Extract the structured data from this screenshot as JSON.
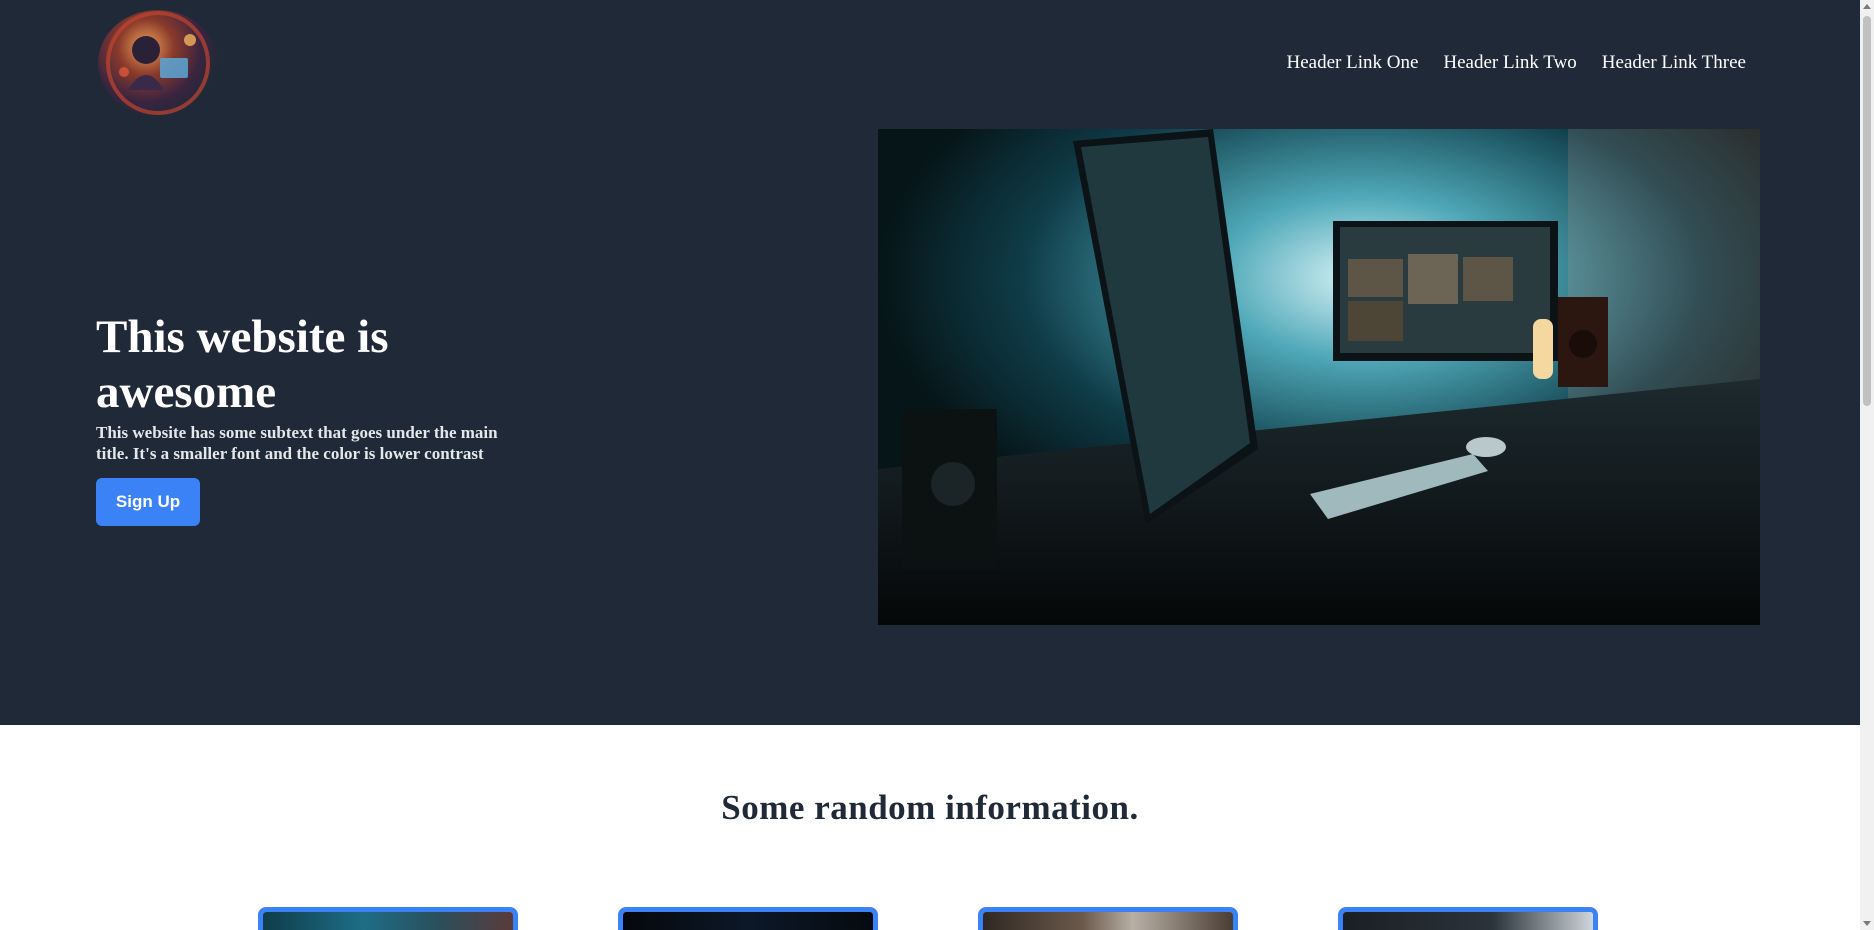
{
  "header": {
    "logo_icon": "coder-avatar-logo",
    "links": [
      "Header Link One",
      "Header Link Two",
      "Header Link Three"
    ]
  },
  "hero": {
    "title": "This website is awesome",
    "subtitle": "This website has some subtext that goes under the main title. It's a smaller font and the color is lower contrast",
    "cta_label": "Sign Up",
    "image_icon": "desk-setup-photo"
  },
  "info": {
    "title": "Some random information.",
    "cards": [
      {
        "image_icon": "card-photo-1"
      },
      {
        "image_icon": "card-photo-2"
      },
      {
        "image_icon": "card-photo-3"
      },
      {
        "image_icon": "card-photo-4"
      }
    ]
  },
  "colors": {
    "hero_bg": "#1f2937",
    "accent": "#3b82f6",
    "page_bg": "#ffffff"
  }
}
